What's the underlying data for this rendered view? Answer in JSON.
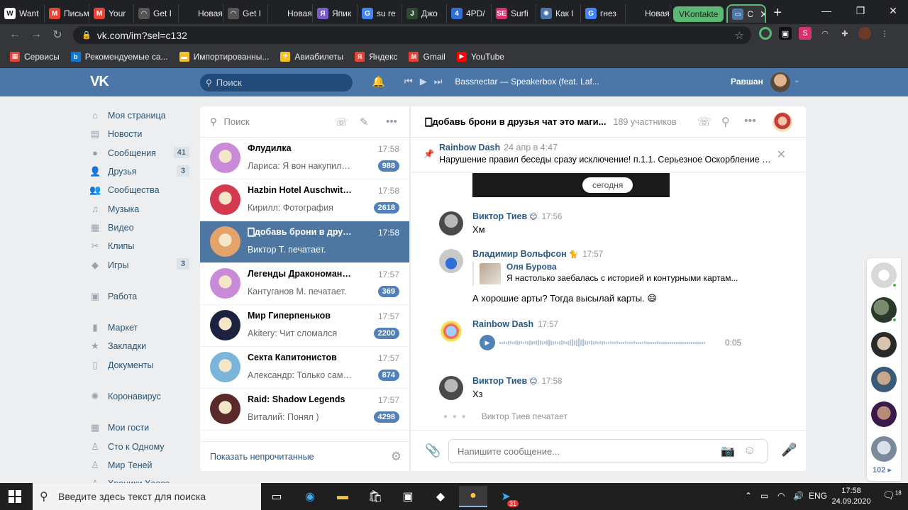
{
  "browser": {
    "tabs": [
      {
        "label": "Want",
        "icon": "W",
        "color": "#ffffff"
      },
      {
        "label": "Письм",
        "icon": "M",
        "color": "#ea4335"
      },
      {
        "label": "Your",
        "icon": "M",
        "color": "#ea4335"
      },
      {
        "label": "Get I",
        "icon": "◠",
        "color": "#555555"
      },
      {
        "label": "Новая вк",
        "icon": "",
        "color": ""
      },
      {
        "label": "Get I",
        "icon": "◠",
        "color": "#555555"
      },
      {
        "label": "Новая вк",
        "icon": "",
        "color": ""
      },
      {
        "label": "Япик",
        "icon": "Я",
        "color": "#7a5dc7"
      },
      {
        "label": "su re",
        "icon": "G",
        "color": "#4285f4"
      },
      {
        "label": "Джо",
        "icon": "J",
        "color": "#2e4a2e"
      },
      {
        "label": "4PD/",
        "icon": "4",
        "color": "#2f6fd6"
      },
      {
        "label": "Surfi",
        "icon": "SE",
        "color": "#d6336c"
      },
      {
        "label": "Как I",
        "icon": "✺",
        "color": "#4a76a8"
      },
      {
        "label": "гнез",
        "icon": "G",
        "color": "#4285f4"
      },
      {
        "label": "Новая вк",
        "icon": "",
        "color": ""
      }
    ],
    "tab_group_label": "VKontakte",
    "active_tab_label": "С",
    "url": "vk.com/im?sel=c132",
    "bookmarks": [
      {
        "label": "Сервисы",
        "icon": "▦",
        "color": "#e94235"
      },
      {
        "label": "Рекомендуемые са...",
        "icon": "b",
        "color": "#0f78d4"
      },
      {
        "label": "Импортированны...",
        "icon": "▬",
        "color": "#f6bf26"
      },
      {
        "label": "Авиабилеты",
        "icon": "✈",
        "color": "#f6bf26"
      },
      {
        "label": "Яндекс",
        "icon": "Я",
        "color": "#ea4335"
      },
      {
        "label": "Gmail",
        "icon": "M",
        "color": "#ea4335"
      },
      {
        "label": "YouTube",
        "icon": "▶",
        "color": "#ff0000"
      }
    ]
  },
  "vk": {
    "search_placeholder": "Поиск",
    "now_playing": "Bassnectar — Speakerbox (feat. Laf...",
    "user_name": "Равшан",
    "menu": [
      {
        "label": "Моя страница",
        "icon": "⌂",
        "count": ""
      },
      {
        "label": "Новости",
        "icon": "▤",
        "count": ""
      },
      {
        "label": "Сообщения",
        "icon": "●",
        "count": "41"
      },
      {
        "label": "Друзья",
        "icon": "👤",
        "count": "3"
      },
      {
        "label": "Сообщества",
        "icon": "👥",
        "count": ""
      },
      {
        "label": "Музыка",
        "icon": "♫",
        "count": ""
      },
      {
        "label": "Видео",
        "icon": "▦",
        "count": ""
      },
      {
        "label": "Клипы",
        "icon": "✂",
        "count": ""
      },
      {
        "label": "Игры",
        "icon": "◆",
        "count": "3"
      },
      {
        "label": "Работа",
        "icon": "▣",
        "count": ""
      },
      {
        "label": "Маркет",
        "icon": "▮",
        "count": ""
      },
      {
        "label": "Закладки",
        "icon": "★",
        "count": ""
      },
      {
        "label": "Документы",
        "icon": "▯",
        "count": ""
      },
      {
        "label": "Коронавирус",
        "icon": "✺",
        "count": ""
      },
      {
        "label": "Мои гости",
        "icon": "▦",
        "count": ""
      },
      {
        "label": "Сто к Одному",
        "icon": "♙",
        "count": ""
      },
      {
        "label": "Мир Теней",
        "icon": "♙",
        "count": ""
      },
      {
        "label": "Хроники Хаоса",
        "icon": "♙",
        "count": ""
      }
    ],
    "conv_search_placeholder": "Поиск",
    "conversations": [
      {
        "name": "Флудилка",
        "time": "17:58",
        "preview": "Лариса: Я вон накупила е...",
        "badge": "988",
        "color": "#c98bd8"
      },
      {
        "name": "Hazbin Hotel Auschwitz | ч...",
        "time": "17:58",
        "preview": "Кирилл: Фотография",
        "badge": "2618",
        "color": "#d43a4f"
      },
      {
        "name": "🀆добавь брони в друзья ...",
        "time": "17:58",
        "preview": "Виктор Т. печатает.",
        "badge": "",
        "color": "#e3a36a"
      },
      {
        "name": "Легенды Дракономании I...",
        "time": "17:57",
        "preview": "Кантуганов М. печатает.",
        "badge": "369",
        "color": "#c98bd8"
      },
      {
        "name": "Мир Гиперпеньков",
        "time": "17:57",
        "preview": "Akitery: Чит сломался",
        "badge": "2200",
        "color": "#1c2340"
      },
      {
        "name": "Секта Капитонистов",
        "time": "17:57",
        "preview": "Александр: Только сам н...",
        "badge": "874",
        "color": "#7bb5d9"
      },
      {
        "name": "Raid: Shadow Legends",
        "time": "17:57",
        "preview": "Виталий: Понял )",
        "badge": "4298",
        "color": "#5a2a2a"
      }
    ],
    "show_unread": "Показать непрочитанные",
    "chat": {
      "title": "🀆добавь брони в друзья чат это маги...",
      "members": "189 участников",
      "pinned_author": "Rainbow Dash",
      "pinned_date": "24 апр в 4:47",
      "pinned_text": "Нарушение правил беседы сразу исключение! п.1.1. Серьезное Оскорбление уч...",
      "day_badge": "сегодня",
      "messages": [
        {
          "author": "Виктор Тиев",
          "emoji": "😊",
          "time": "17:56",
          "text": "Хм"
        },
        {
          "author": "Владимир Вольфсон",
          "emoji": "🐈",
          "time": "17:57",
          "reply_author": "Оля Бурова",
          "reply_text": "Я настолько заебалась с историей и контурными картам...",
          "text": "А хорошие арты? Тогда высылай карты. 😄"
        },
        {
          "author": "Rainbow Dash",
          "emoji": "",
          "time": "17:57",
          "voice_duration": "0:05"
        },
        {
          "author": "Виктор Тиев",
          "emoji": "😊",
          "time": "17:58",
          "text": "Хз"
        }
      ],
      "typing": "Виктор Тиев печатает",
      "composer_placeholder": "Напишите сообщение..."
    },
    "friends_count": "102"
  },
  "taskbar": {
    "search_placeholder": "Введите здесь текст для поиска",
    "telegram_badge": "31",
    "language": "ENG",
    "time": "17:58",
    "date": "24.09.2020",
    "notifications": "18"
  }
}
